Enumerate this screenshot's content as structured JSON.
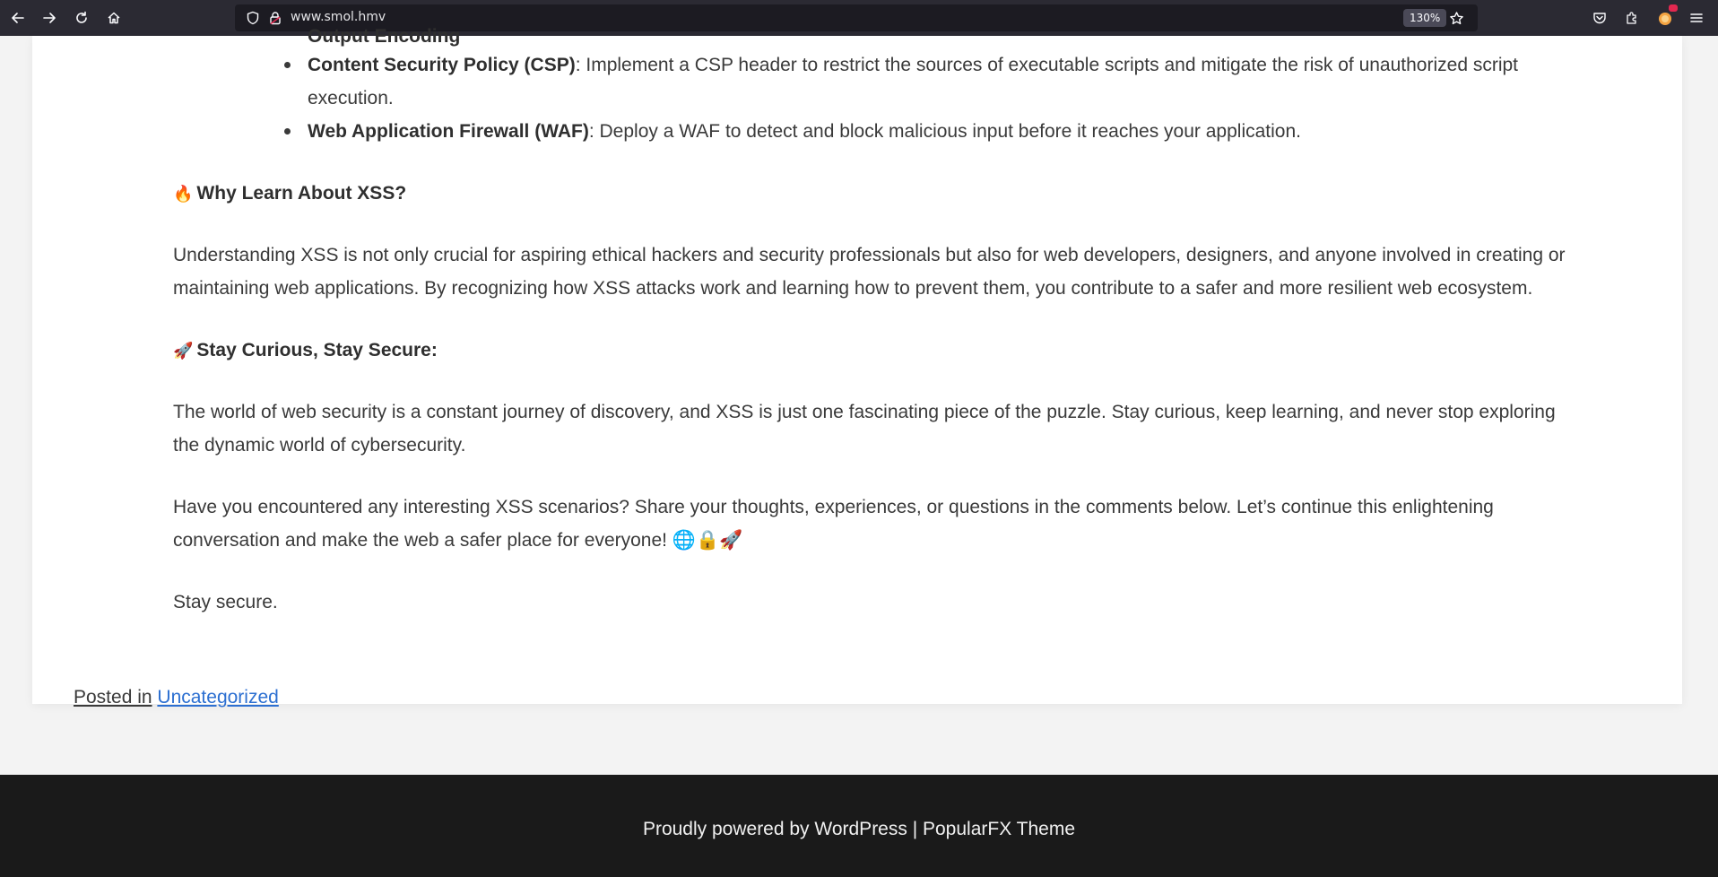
{
  "browser": {
    "url": "www.smol.hmv",
    "zoom": "130%",
    "icons": [
      "back-icon",
      "forward-icon",
      "reload-icon",
      "home-icon",
      "shield-icon",
      "lock-icon",
      "bookmark-star-icon",
      "pocket-icon",
      "extensions-icon",
      "firefox-account-icon",
      "menu-icon"
    ]
  },
  "article": {
    "partial_item_label": "Output Encoding",
    "bullets": [
      {
        "label": "Content Security Policy (CSP)",
        "text": ": Implement a CSP header to restrict the sources of executable scripts and mitigate the risk of unauthorized script execution."
      },
      {
        "label": "Web Application Firewall (WAF)",
        "text": ": Deploy a WAF to detect and block malicious input before it reaches your application."
      }
    ],
    "section1": {
      "emoji": "🔥",
      "heading": "Why Learn About XSS?",
      "body": "Understanding XSS is not only crucial for aspiring ethical hackers and security professionals but also for web developers, designers, and anyone involved in creating or maintaining web applications. By recognizing how XSS attacks work and learning how to prevent them, you contribute to a safer and more resilient web ecosystem."
    },
    "section2": {
      "emoji": "🚀",
      "heading": "Stay Curious, Stay Secure:",
      "body": "The world of web security is a constant journey of discovery, and XSS is just one fascinating piece of the puzzle. Stay curious, keep learning, and never stop exploring the dynamic world of cybersecurity."
    },
    "cta": "Have you encountered any interesting XSS scenarios? Share your thoughts, experiences, or questions in the comments below. Let’s continue this enlightening conversation and make the web a safer place for everyone! 🌐🔒🚀",
    "signoff": "Stay secure.",
    "posted_in_label": "Posted in",
    "category": "Uncategorized"
  },
  "footer": {
    "text": "Proudly powered by WordPress | PopularFX Theme"
  },
  "colors": {
    "toolbar_bg": "#2b2a33",
    "urlbar_bg": "#1c1b22",
    "link": "#2c6fd1",
    "footer_bg": "#1a1a1a",
    "page_bg": "#f3f3f3"
  }
}
